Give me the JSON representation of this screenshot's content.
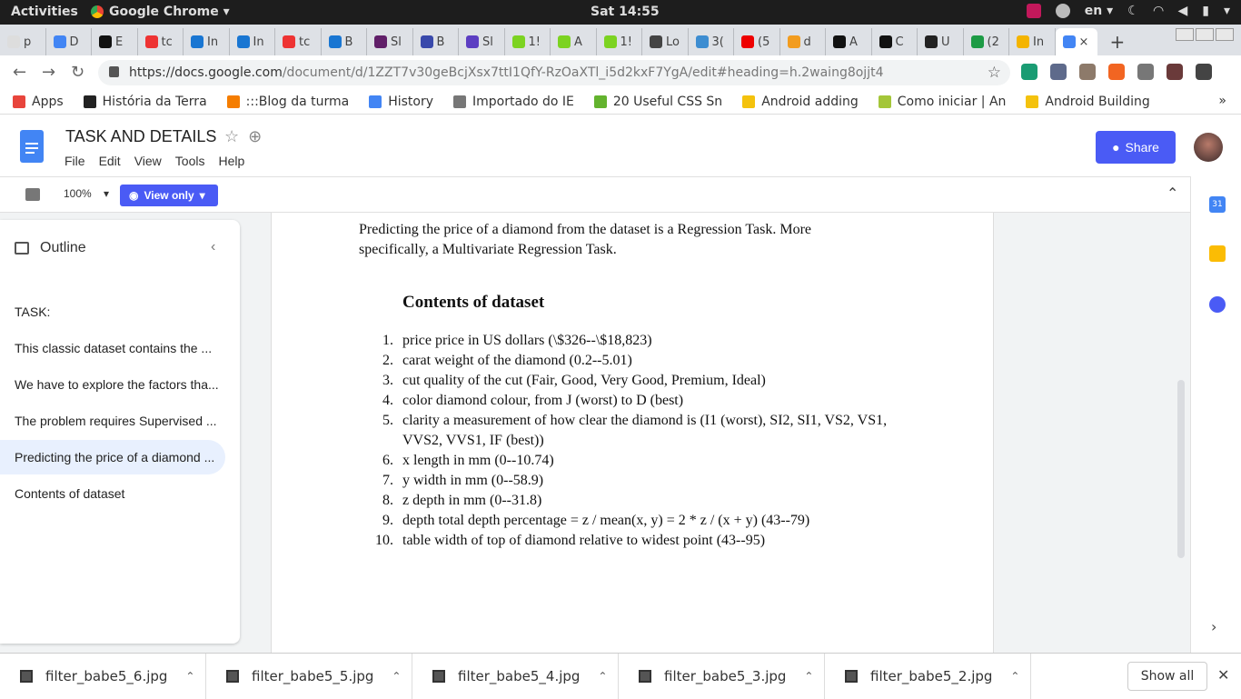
{
  "system": {
    "activities": "Activities",
    "app_name": "Google Chrome ▾",
    "clock": "Sat 14:55",
    "lang": "en ▾"
  },
  "tabs": [
    {
      "label": "p",
      "color": "#ddd"
    },
    {
      "label": "D",
      "color": "#4285f4"
    },
    {
      "label": "E",
      "color": "#111"
    },
    {
      "label": "tc",
      "color": "#e33"
    },
    {
      "label": "In",
      "color": "#1976d2"
    },
    {
      "label": "In",
      "color": "#1976d2"
    },
    {
      "label": "tc",
      "color": "#e33"
    },
    {
      "label": "B",
      "color": "#1976d2"
    },
    {
      "label": "Sl",
      "color": "#611f69"
    },
    {
      "label": "B",
      "color": "#3949ab"
    },
    {
      "label": "Sl",
      "color": "#5c3ec2"
    },
    {
      "label": "1!",
      "color": "#7cd321"
    },
    {
      "label": "A",
      "color": "#7cd321"
    },
    {
      "label": "1!",
      "color": "#7cd321"
    },
    {
      "label": "Lo",
      "color": "#444"
    },
    {
      "label": "3(",
      "color": "#3d8dd1"
    },
    {
      "label": "(5",
      "color": "#e00"
    },
    {
      "label": "d",
      "color": "#f29c1f"
    },
    {
      "label": "A",
      "color": "#111"
    },
    {
      "label": "C",
      "color": "#111"
    },
    {
      "label": "U",
      "color": "#222"
    },
    {
      "label": "(2",
      "color": "#1d9b45"
    },
    {
      "label": "In",
      "color": "#f4b400"
    }
  ],
  "active_tab_close": "×",
  "new_tab": "+",
  "omnibox": {
    "url_host": "https://docs.google.com",
    "url_path": "/document/d/1ZZT7v30geBcjXsx7ttI1QfY-RzOaXTl_i5d2kxF7YgA/edit#heading=h.2waing8ojjt4",
    "bookmark_star": "☆"
  },
  "extensions": [
    "#1a9c73",
    "#5e6a8b",
    "#8d7a6a",
    "#f26522",
    "#777",
    "#6a3a3a",
    "#444"
  ],
  "bookmarks": [
    {
      "label": "Apps",
      "color": "#e8453c"
    },
    {
      "label": "História da Terra",
      "color": "#222"
    },
    {
      "label": ":::Blog da turma",
      "color": "#f57d00"
    },
    {
      "label": "History",
      "color": "#4285f4"
    },
    {
      "label": "Importado do IE",
      "color": "#777"
    },
    {
      "label": "20 Useful CSS Sn",
      "color": "#63b32e"
    },
    {
      "label": "Android adding",
      "color": "#f4c20d"
    },
    {
      "label": "Como iniciar | An",
      "color": "#a4c639"
    },
    {
      "label": "Android Building",
      "color": "#f4c20d"
    }
  ],
  "bookmarks_more": "»",
  "doc": {
    "title": "TASK AND DETAILS",
    "menus": [
      "File",
      "Edit",
      "View",
      "Tools",
      "Help"
    ],
    "share": "Share",
    "zoom": "100%",
    "mode": "View only"
  },
  "outline": {
    "heading": "Outline",
    "items": [
      "TASK:",
      "This classic dataset contains the ...",
      "We have to explore the factors tha...",
      "The problem requires Supervised ...",
      "Predicting the price of a diamond ...",
      "Contents of dataset"
    ]
  },
  "page": {
    "paragraph": "Predicting the price of a diamond from the dataset is a Regression Task. More specifically, a Multivariate Regression Task.",
    "heading": "Contents of dataset",
    "list": [
      {
        "n": "1.",
        "text": "price price in US dollars (\\$326--\\$18,823)"
      },
      {
        "n": "2.",
        "text": "carat weight of the diamond (0.2--5.01)"
      },
      {
        "n": "3.",
        "text": "cut quality of the cut (Fair, Good, Very Good, Premium, Ideal)"
      },
      {
        "n": "4.",
        "text": "color diamond colour, from J (worst) to D (best)"
      },
      {
        "n": "5.",
        "text": "clarity a measurement of how clear the diamond is (I1 (worst), SI2, SI1, VS2, VS1, VVS2, VVS1, IF (best))"
      },
      {
        "n": "6.",
        "text": "x length in mm (0--10.74)"
      },
      {
        "n": "7.",
        "text": "y width in mm (0--58.9)"
      },
      {
        "n": "8.",
        "text": "z depth in mm (0--31.8)"
      },
      {
        "n": "9.",
        "text": "depth total depth percentage = z / mean(x, y) = 2 * z / (x + y) (43--79)"
      },
      {
        "n": "10.",
        "text": "table width of top of diamond relative to widest point (43--95)"
      }
    ]
  },
  "side_panel": {
    "calendar_label": "31",
    "colors": {
      "calendar": "#4285f4",
      "keep": "#fbbc04",
      "tasks": "#4a5bf5"
    }
  },
  "downloads": {
    "files": [
      "filter_babe5_6.jpg",
      "filter_babe5_5.jpg",
      "filter_babe5_4.jpg",
      "filter_babe5_3.jpg",
      "filter_babe5_2.jpg"
    ],
    "show_all": "Show all"
  }
}
